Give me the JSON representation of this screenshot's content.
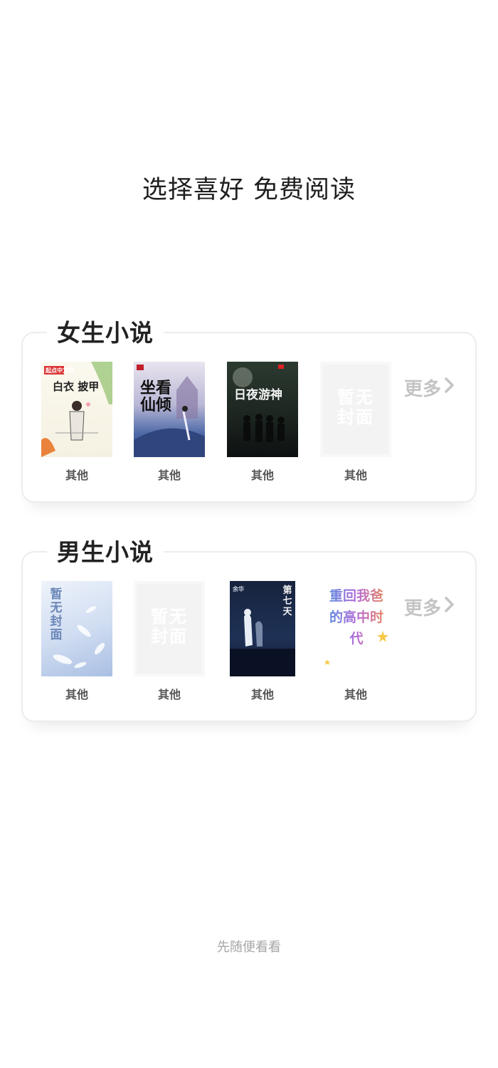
{
  "title": "选择喜好  免费阅读",
  "sections": [
    {
      "title": "女生小说",
      "books": [
        {
          "label": "其他",
          "cover_text": "白衣 披甲",
          "cover_badge": "起点中文网"
        },
        {
          "label": "其他",
          "cover_text": "坐看仙倾"
        },
        {
          "label": "其他",
          "cover_text": "日夜游神"
        },
        {
          "label": "其他",
          "cover_text": "暂无封面"
        }
      ],
      "more_label": "更多"
    },
    {
      "title": "男生小说",
      "books": [
        {
          "label": "其他",
          "cover_text": "暂无封面"
        },
        {
          "label": "其他",
          "cover_text": "暂无封面"
        },
        {
          "label": "其他",
          "cover_text": "第七天",
          "cover_author": "余华"
        },
        {
          "label": "其他",
          "cover_text": "重回我爸的高中时代"
        }
      ],
      "more_label": "更多"
    }
  ],
  "skip_label": "先随便看看",
  "colors": {
    "title": "#1f1f1f",
    "section_border": "#ececec",
    "label": "#555555",
    "more": "#c4c4c4",
    "skip": "#a6a6a6"
  }
}
